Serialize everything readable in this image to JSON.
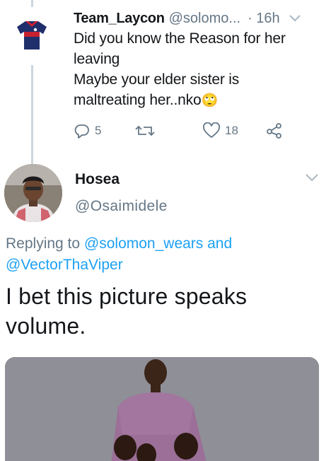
{
  "tweet1": {
    "display_name": "Team_Laycon",
    "handle": "@solomo...",
    "time": "· 16h",
    "text_lines": [
      "Did  you know the Reason for her",
      "leaving",
      "Maybe your elder sister is",
      "maltreating her..nko"
    ],
    "emoji": "🙄",
    "actions": {
      "reply_count": "5",
      "retweet_count": "",
      "like_count": "18"
    },
    "avatar_icon": "jersey-icon"
  },
  "tweet2": {
    "display_name": "Hosea",
    "handle": "@Osaimidele",
    "replying_prefix": "Replying to ",
    "mention_1": "@solomon_wears",
    "replying_joiner": " and",
    "mention_2": "@VectorThaViper",
    "text": "I bet this picture speaks volume.",
    "avatar_icon": "profile-photo"
  },
  "colors": {
    "text_primary": "#14171a",
    "text_secondary": "#657786",
    "link": "#1da1f2",
    "thread_line": "#ccd6dd"
  }
}
